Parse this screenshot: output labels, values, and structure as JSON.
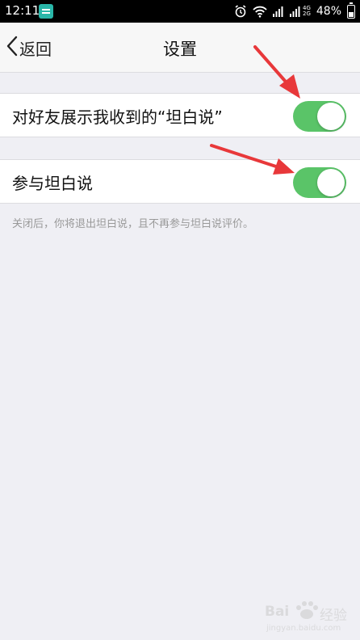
{
  "status_bar": {
    "time": "12:11",
    "network_top": "4G",
    "network_bottom": "2G",
    "battery": "48%",
    "battery_level": 0.48
  },
  "nav": {
    "back_label": "返回",
    "title": "设置"
  },
  "settings": [
    {
      "label": "对好友展示我收到的“坦白说”",
      "enabled": true
    },
    {
      "label": "参与坦白说",
      "enabled": true
    }
  ],
  "footnote": "关闭后，你将退出坦白说，且不再参与坦白说评价。",
  "colors": {
    "toggle_on": "#5ac468",
    "background": "#efeff4",
    "annotation_arrow": "#e8383a"
  },
  "watermark": {
    "brand": "Bai",
    "service": "经验",
    "url": "jingyan.baidu.com"
  }
}
